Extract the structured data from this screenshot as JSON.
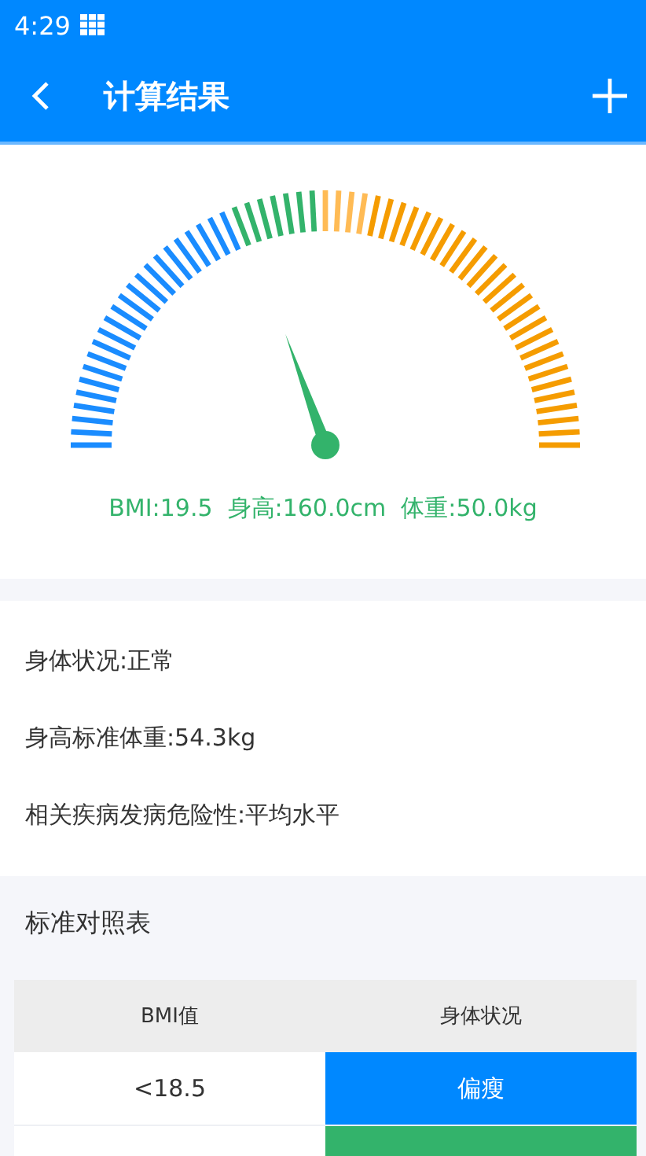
{
  "status_bar": {
    "time": "4:29"
  },
  "app_bar": {
    "title": "计算结果"
  },
  "gauge": {
    "summary": "BMI:19.5  身高:160.0cm  体重:50.0kg"
  },
  "info": [
    "身体状况:正常",
    "身高标准体重:54.3kg",
    "相关疾病发病危险性:平均水平"
  ],
  "table": {
    "title": "标准对照表",
    "columns": [
      "BMI值",
      "身体状况"
    ],
    "rows": [
      {
        "bmi": "<18.5",
        "status": "偏瘦",
        "color": "#0088ff"
      },
      {
        "color": "#33b36b"
      }
    ]
  }
}
